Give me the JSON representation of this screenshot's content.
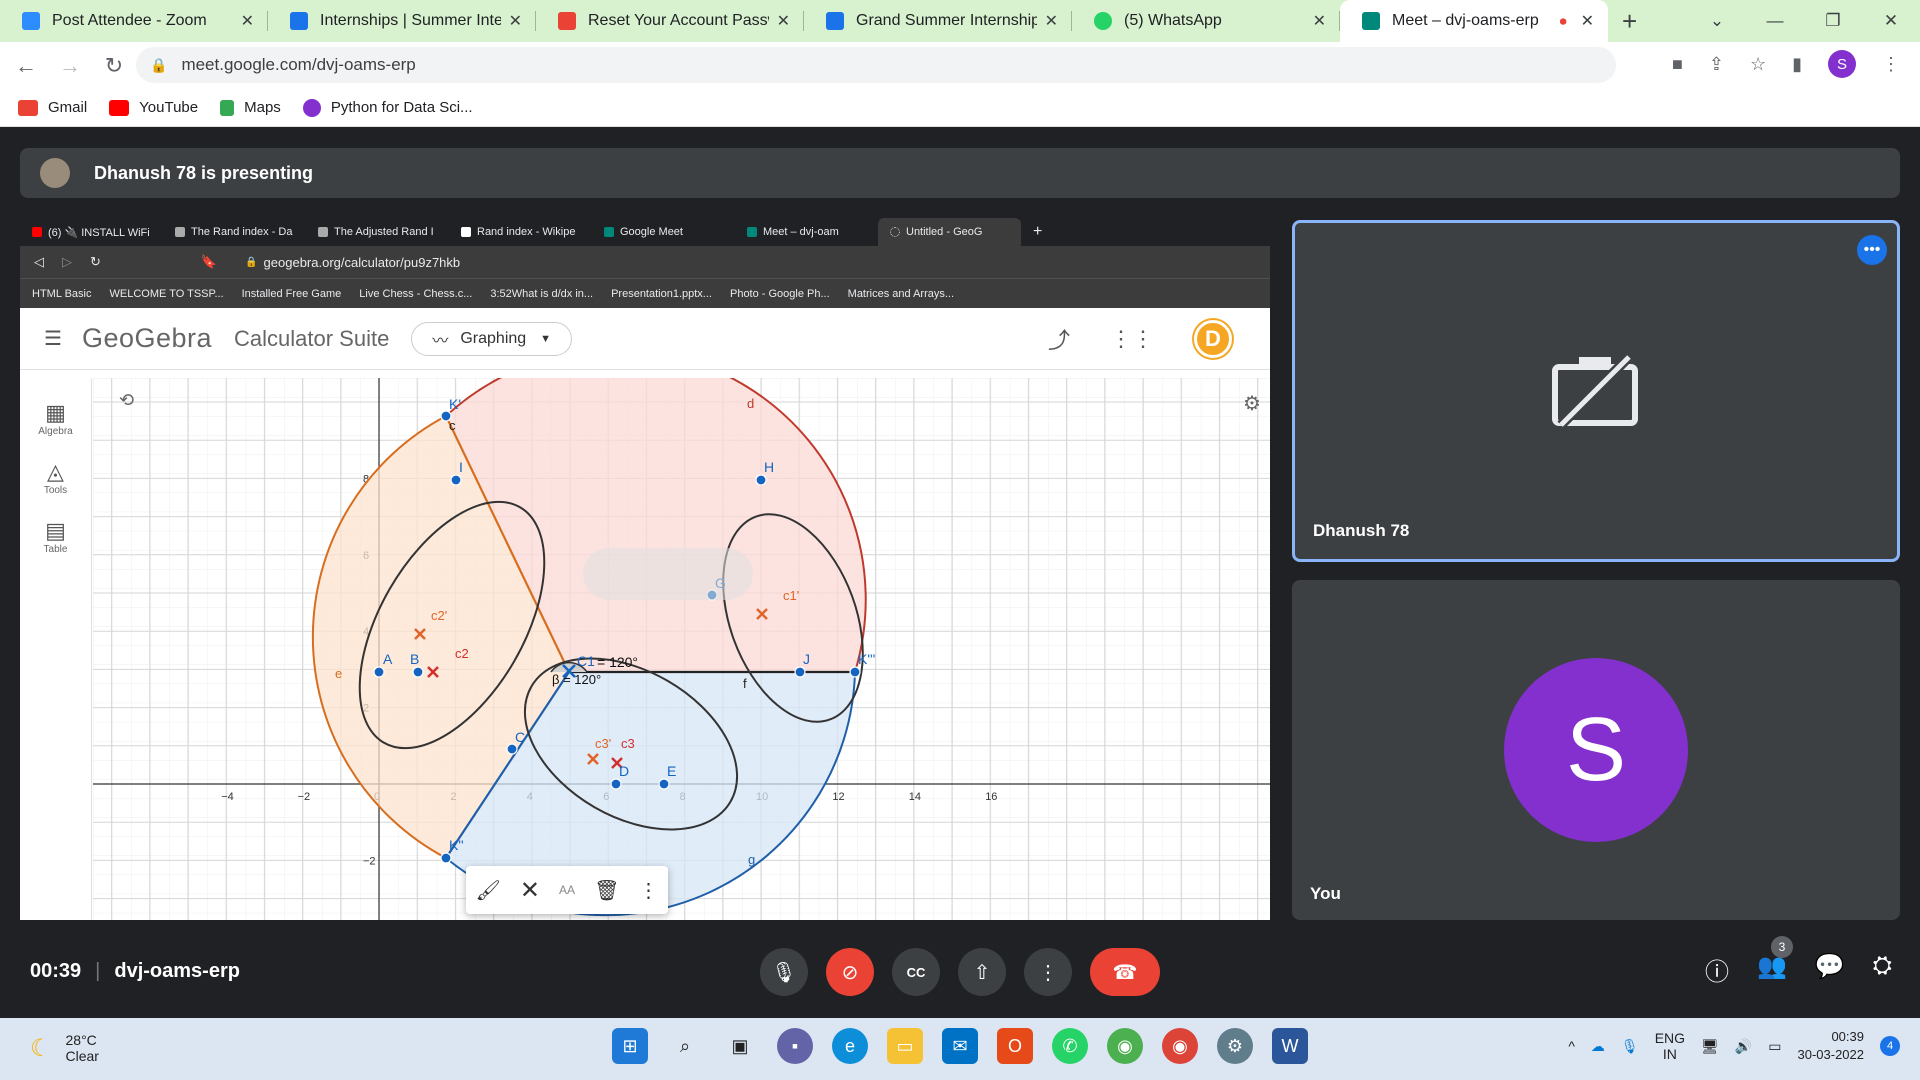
{
  "browser": {
    "tabs": [
      {
        "title": "Post Attendee - Zoom",
        "color": "#2d8cff"
      },
      {
        "title": "Internships | Summer Intern",
        "color": "#1a73e8"
      },
      {
        "title": "Reset Your Account Passwo",
        "color": "#ea4335"
      },
      {
        "title": "Grand Summer Internship F",
        "color": "#1a73e8"
      },
      {
        "title": "(5) WhatsApp",
        "color": "#25d366"
      },
      {
        "title": "Meet – dvj-oams-erp",
        "color": "#00897b",
        "active": true
      }
    ],
    "url": "meet.google.com/dvj-oams-erp",
    "profile_initial": "S",
    "bookmarks": [
      {
        "label": "Gmail",
        "color": "#ea4335"
      },
      {
        "label": "YouTube",
        "color": "#ff0000"
      },
      {
        "label": "Maps",
        "color": "#34a853"
      },
      {
        "label": "Python for Data Sci...",
        "color": "#8430ce"
      }
    ]
  },
  "meet": {
    "presenting_banner": "Dhanush 78 is presenting",
    "time": "00:39",
    "meeting_code": "dvj-oams-erp",
    "participants_count": "3",
    "tiles": [
      {
        "name": "Dhanush 78",
        "camera_off": true
      },
      {
        "name": "You",
        "initial": "S"
      }
    ]
  },
  "shared_screen": {
    "tabs": [
      "(6) 🔌 INSTALL WiFi",
      "The Rand index - Da",
      "The Adjusted Rand I",
      "Rand index - Wikipe",
      "Google Meet",
      "Meet – dvj-oam",
      "Untitled - GeoG"
    ],
    "url": "geogebra.org/calculator/pu9z7hkb",
    "bookmarks": [
      "HTML Basic",
      "WELCOME TO TSSP...",
      "Installed Free Game",
      "Live Chess - Chess.c...",
      "3:52What is d/dx in...",
      "Presentation1.pptx...",
      "Photo - Google Ph...",
      "Matrices and Arrays..."
    ],
    "geogebra": {
      "logo": "GeoGebra",
      "suite": "Calculator Suite",
      "mode": "Graphing",
      "user_initial": "D",
      "tools": [
        "Algebra",
        "Tools",
        "Table"
      ],
      "x_ticks": [
        "−4",
        "−2",
        "0",
        "2",
        "4",
        "6",
        "8",
        "10",
        "12",
        "14",
        "16"
      ],
      "y_ticks": [
        "8",
        "6",
        "4",
        "2",
        "−2"
      ],
      "labels": {
        "points": [
          "K'",
          "I",
          "A",
          "B",
          "H",
          "G",
          "J",
          "K'''",
          "C",
          "D",
          "E",
          "K''",
          "C1"
        ],
        "curves": [
          "c",
          "d",
          "e",
          "f",
          "g"
        ],
        "markers": [
          "c1'",
          "c2'",
          "c2",
          "c3'",
          "c3"
        ],
        "angle_text": "= 120°",
        "angle_beta": "β = 120°"
      }
    }
  },
  "taskbar": {
    "temperature": "28°C",
    "condition": "Clear",
    "language": "ENG",
    "region": "IN",
    "time": "00:39",
    "date": "30-03-2022",
    "notifications": "4"
  }
}
